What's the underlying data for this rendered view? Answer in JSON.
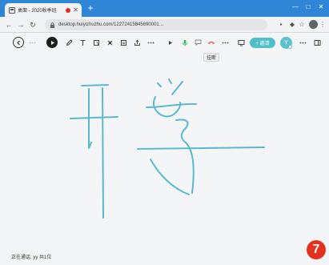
{
  "browser": {
    "tab": {
      "title": "桌面 - 2020秋季班"
    },
    "address": {
      "url": "desktop.huiyizhuzhu.com/12272415845690001…"
    }
  },
  "toolbar": {
    "hangup_tooltip": "挂断",
    "invite_label": "+ 邀请",
    "avatar_initial": "Y"
  },
  "status_bar": {
    "text": "正在通话: yy 共1位"
  },
  "badge": {
    "number": "7"
  },
  "colors": {
    "ink": "#5ab9cf",
    "accent": "#4fc0c8",
    "mic": "#35b865",
    "hangup": "#e04848",
    "badge": "#e3321f",
    "chrome": "#2f86d6"
  },
  "icons": [
    "favicon-icon",
    "close-icon",
    "plus-icon",
    "back-icon",
    "forward-icon",
    "reload-icon",
    "lock-icon",
    "star-icon",
    "pointer-icon",
    "pen-icon",
    "text-icon",
    "shape-icon",
    "eraser-icon",
    "image-icon",
    "upload-icon",
    "more-icon",
    "play-icon",
    "mic-icon",
    "chat-icon",
    "hangup-icon",
    "screen-share-icon",
    "panel-icon"
  ]
}
